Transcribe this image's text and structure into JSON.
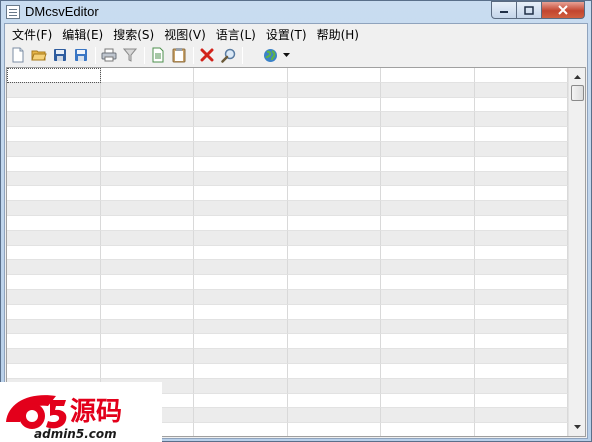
{
  "window": {
    "title": "DMcsvEditor",
    "controls": {
      "minimize_icon": "minimize-icon",
      "maximize_icon": "maximize-icon",
      "close_icon": "close-icon"
    }
  },
  "menu": [
    {
      "label": "文件(F)"
    },
    {
      "label": "编辑(E)"
    },
    {
      "label": "搜索(S)"
    },
    {
      "label": "视图(V)"
    },
    {
      "label": "语言(L)"
    },
    {
      "label": "设置(T)"
    },
    {
      "label": "帮助(H)"
    }
  ],
  "toolbar": [
    {
      "icon": "new-file-icon"
    },
    {
      "icon": "open-folder-icon"
    },
    {
      "icon": "save-icon"
    },
    {
      "icon": "save-as-icon"
    },
    {
      "icon": "print-icon"
    },
    {
      "icon": "filter-icon"
    },
    {
      "icon": "copy-icon"
    },
    {
      "icon": "paste-icon"
    },
    {
      "icon": "delete-icon"
    },
    {
      "icon": "search-icon"
    },
    {
      "icon": "globe-icon"
    }
  ],
  "grid": {
    "columns": 6,
    "rows": 25
  },
  "watermark": {
    "logo_text": "a5源码",
    "url": "admin5.com"
  },
  "colors": {
    "accent": "#2a5fb0",
    "watermark_red": "#e3001b",
    "close_red": "#c3452f"
  }
}
